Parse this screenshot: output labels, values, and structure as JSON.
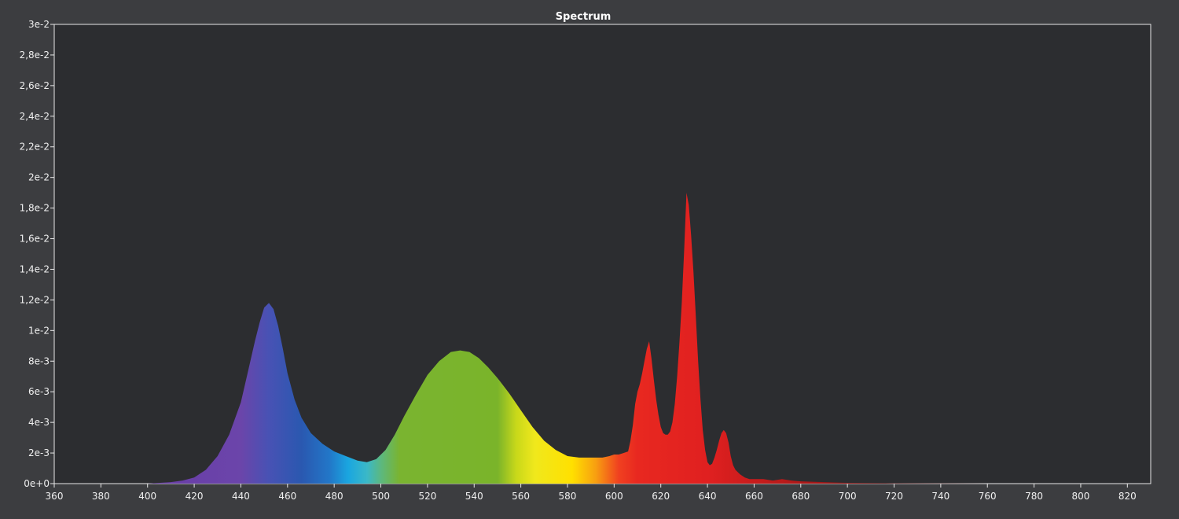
{
  "chart_data": {
    "type": "area",
    "title": "Spectrum",
    "xlabel": "",
    "ylabel": "",
    "xlim": [
      360,
      830
    ],
    "ylim": [
      0,
      0.03
    ],
    "grid": false,
    "x_ticks": [
      "360",
      "380",
      "400",
      "420",
      "440",
      "460",
      "480",
      "500",
      "520",
      "540",
      "560",
      "580",
      "600",
      "620",
      "640",
      "660",
      "680",
      "700",
      "720",
      "740",
      "760",
      "780",
      "800",
      "820"
    ],
    "y_ticks": [
      "0e+0",
      "2e-3",
      "4e-3",
      "6e-3",
      "8e-3",
      "1e-2",
      "1,2e-2",
      "1,4e-2",
      "1,6e-2",
      "1,8e-2",
      "2e-2",
      "2,2e-2",
      "2,4e-2",
      "2,6e-2",
      "2,8e-2",
      "3e-2"
    ],
    "y_tick_values": [
      0,
      0.002,
      0.004,
      0.006,
      0.008,
      0.01,
      0.012,
      0.014,
      0.016,
      0.018,
      0.02,
      0.022,
      0.024,
      0.026,
      0.028,
      0.03
    ],
    "series": [
      {
        "x": [
          360,
          400,
          410,
          415,
          420,
          425,
          430,
          435,
          440,
          443,
          446,
          448,
          450,
          452,
          454,
          456,
          458,
          460,
          463,
          466,
          470,
          475,
          480,
          485,
          490,
          494,
          498,
          502,
          506,
          510,
          515,
          520,
          525,
          530,
          534,
          538,
          542,
          546,
          550,
          555,
          560,
          565,
          570,
          575,
          580,
          585,
          590,
          595,
          598,
          600,
          602,
          604,
          606,
          607,
          608,
          609,
          610,
          611,
          612,
          613,
          614,
          615,
          616,
          617,
          618,
          619,
          620,
          621,
          622,
          623,
          624,
          625,
          626,
          627,
          628,
          629,
          630,
          631,
          632,
          633,
          634,
          635,
          636,
          637,
          638,
          639,
          640,
          641,
          642,
          643,
          644,
          645,
          646,
          647,
          648,
          649,
          650,
          651,
          652,
          654,
          656,
          658,
          660,
          664,
          668,
          672,
          676,
          680,
          690,
          700,
          720,
          760,
          800,
          830
        ],
        "y": [
          0,
          0,
          0.0001,
          0.0002,
          0.0004,
          0.0009,
          0.0018,
          0.0032,
          0.0053,
          0.0073,
          0.0093,
          0.0105,
          0.0115,
          0.0118,
          0.0114,
          0.0103,
          0.0088,
          0.0072,
          0.0055,
          0.0043,
          0.0033,
          0.0026,
          0.0021,
          0.0018,
          0.0015,
          0.0014,
          0.0016,
          0.0022,
          0.0032,
          0.0044,
          0.0058,
          0.0071,
          0.008,
          0.0086,
          0.0087,
          0.0086,
          0.0082,
          0.0076,
          0.0069,
          0.0059,
          0.0048,
          0.0037,
          0.0028,
          0.0022,
          0.0018,
          0.0017,
          0.0017,
          0.0017,
          0.0018,
          0.0019,
          0.0019,
          0.002,
          0.0021,
          0.0028,
          0.0038,
          0.0052,
          0.006,
          0.0065,
          0.0072,
          0.008,
          0.0088,
          0.0093,
          0.0082,
          0.0068,
          0.0055,
          0.0045,
          0.0037,
          0.0033,
          0.0032,
          0.0032,
          0.0034,
          0.004,
          0.0052,
          0.007,
          0.0092,
          0.0118,
          0.0152,
          0.019,
          0.0182,
          0.0162,
          0.0138,
          0.011,
          0.008,
          0.0055,
          0.0035,
          0.0022,
          0.0014,
          0.0012,
          0.0013,
          0.0017,
          0.0022,
          0.0028,
          0.0033,
          0.0035,
          0.0033,
          0.0027,
          0.0018,
          0.0012,
          0.0009,
          0.0006,
          0.0004,
          0.0003,
          0.0003,
          0.0003,
          0.0002,
          0.0003,
          0.0002,
          0.00015,
          0.0001,
          5e-05,
          2e-05,
          0,
          0,
          0
        ]
      }
    ],
    "fill_colors": [
      {
        "at": 415,
        "color": "#6a3fa8"
      },
      {
        "at": 440,
        "color": "#6b45aa"
      },
      {
        "at": 452,
        "color": "#4852b4"
      },
      {
        "at": 466,
        "color": "#2a58b0"
      },
      {
        "at": 478,
        "color": "#2277c8"
      },
      {
        "at": 486,
        "color": "#1aa6e0"
      },
      {
        "at": 494,
        "color": "#3ab8c8"
      },
      {
        "at": 500,
        "color": "#5cb880"
      },
      {
        "at": 508,
        "color": "#7ab430"
      },
      {
        "at": 550,
        "color": "#7ab42a"
      },
      {
        "at": 558,
        "color": "#c8d81a"
      },
      {
        "at": 566,
        "color": "#f0e81c"
      },
      {
        "at": 582,
        "color": "#ffe000"
      },
      {
        "at": 592,
        "color": "#f8a010"
      },
      {
        "at": 602,
        "color": "#f04020"
      },
      {
        "at": 610,
        "color": "#e82820"
      },
      {
        "at": 640,
        "color": "#e02020"
      },
      {
        "at": 680,
        "color": "#b01818"
      },
      {
        "at": 720,
        "color": "#701010"
      }
    ],
    "colors": {
      "page_background": "#3c3d40",
      "plot_background": "#2c2d30",
      "axis": "#e8e8e8",
      "text": "#f0f0f0"
    }
  }
}
